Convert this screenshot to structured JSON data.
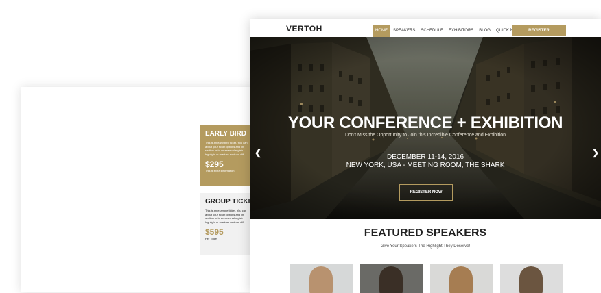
{
  "tickets": [
    {
      "title": "EARLY BIRD",
      "desc": "This is an early bird ticket. You can\nabout your ticket options and lin\nsection or to an external registr\nhighlight or mark as sold out diff",
      "price": "$295",
      "per": "This is extra information"
    },
    {
      "title": "GROUP TICKET",
      "desc": "This is an example ticket. You can\nabout your ticket options and lin\nsection or to an external registr\nhighlight or mark as sold out diff",
      "price": "$595",
      "per": "Per Ticket"
    }
  ],
  "site": {
    "logo": "VERTOH",
    "nav": [
      "HOME",
      "SPEAKERS",
      "SCHEDULE",
      "EXHIBITORS",
      "BLOG",
      "QUICK NAV"
    ],
    "register": "REGISTER"
  },
  "hero": {
    "title": "YOUR CONFERENCE + EXHIBITION",
    "subtitle": "Don't Miss the Opportunity to Join this Incredible Conference and Exhibition",
    "date": "DECEMBER 11-14, 2016",
    "venue": "NEW YORK, USA - MEETING ROOM, THE SHARK",
    "button": "REGISTER NOW"
  },
  "featured": {
    "title": "FEATURED SPEAKERS",
    "subtitle": "Give Your Speakers The Highlight They Deserve!"
  },
  "colors": {
    "accent": "#b49b5f"
  },
  "icons": {
    "prev": "chevron-left-icon",
    "next": "chevron-right-icon",
    "down": "chevron-down-icon"
  }
}
